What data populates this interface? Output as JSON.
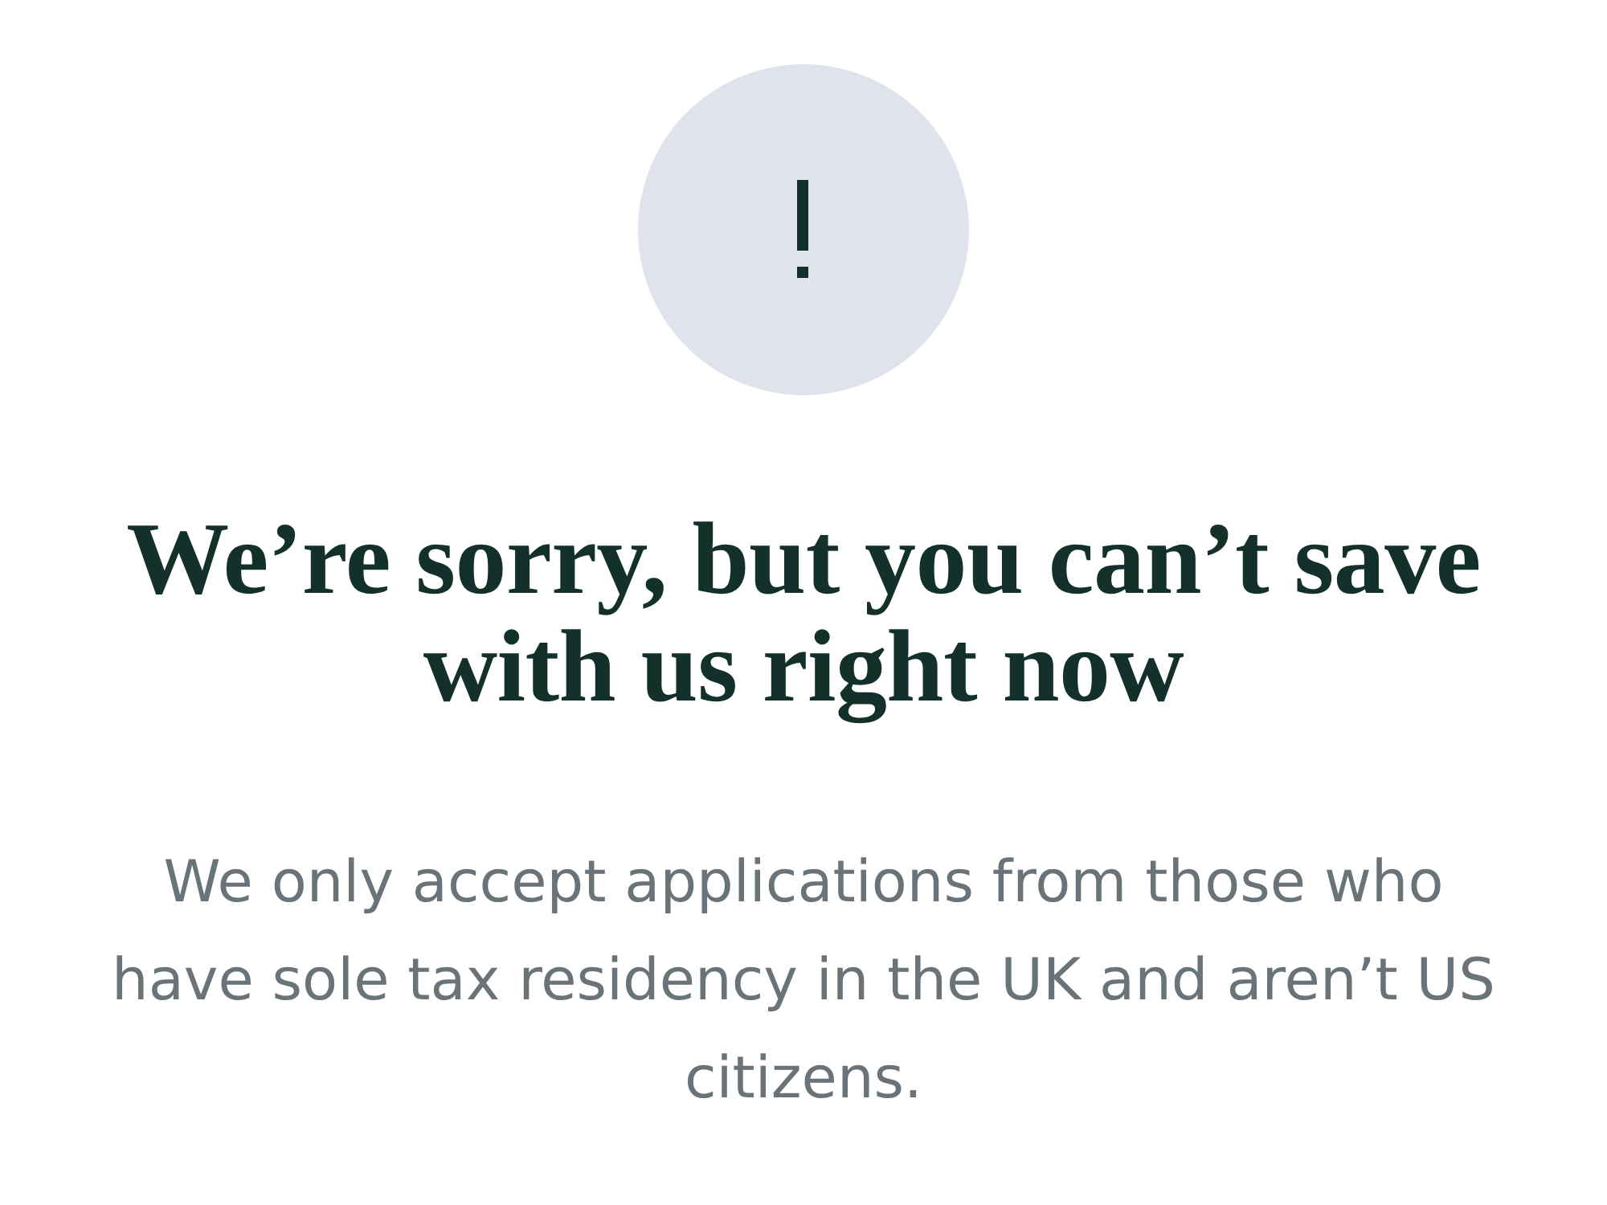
{
  "heading": "We’re sorry, but you can’t save with us right now",
  "message": "We only accept applications from those who have sole tax residency in the UK and aren’t US citizens."
}
